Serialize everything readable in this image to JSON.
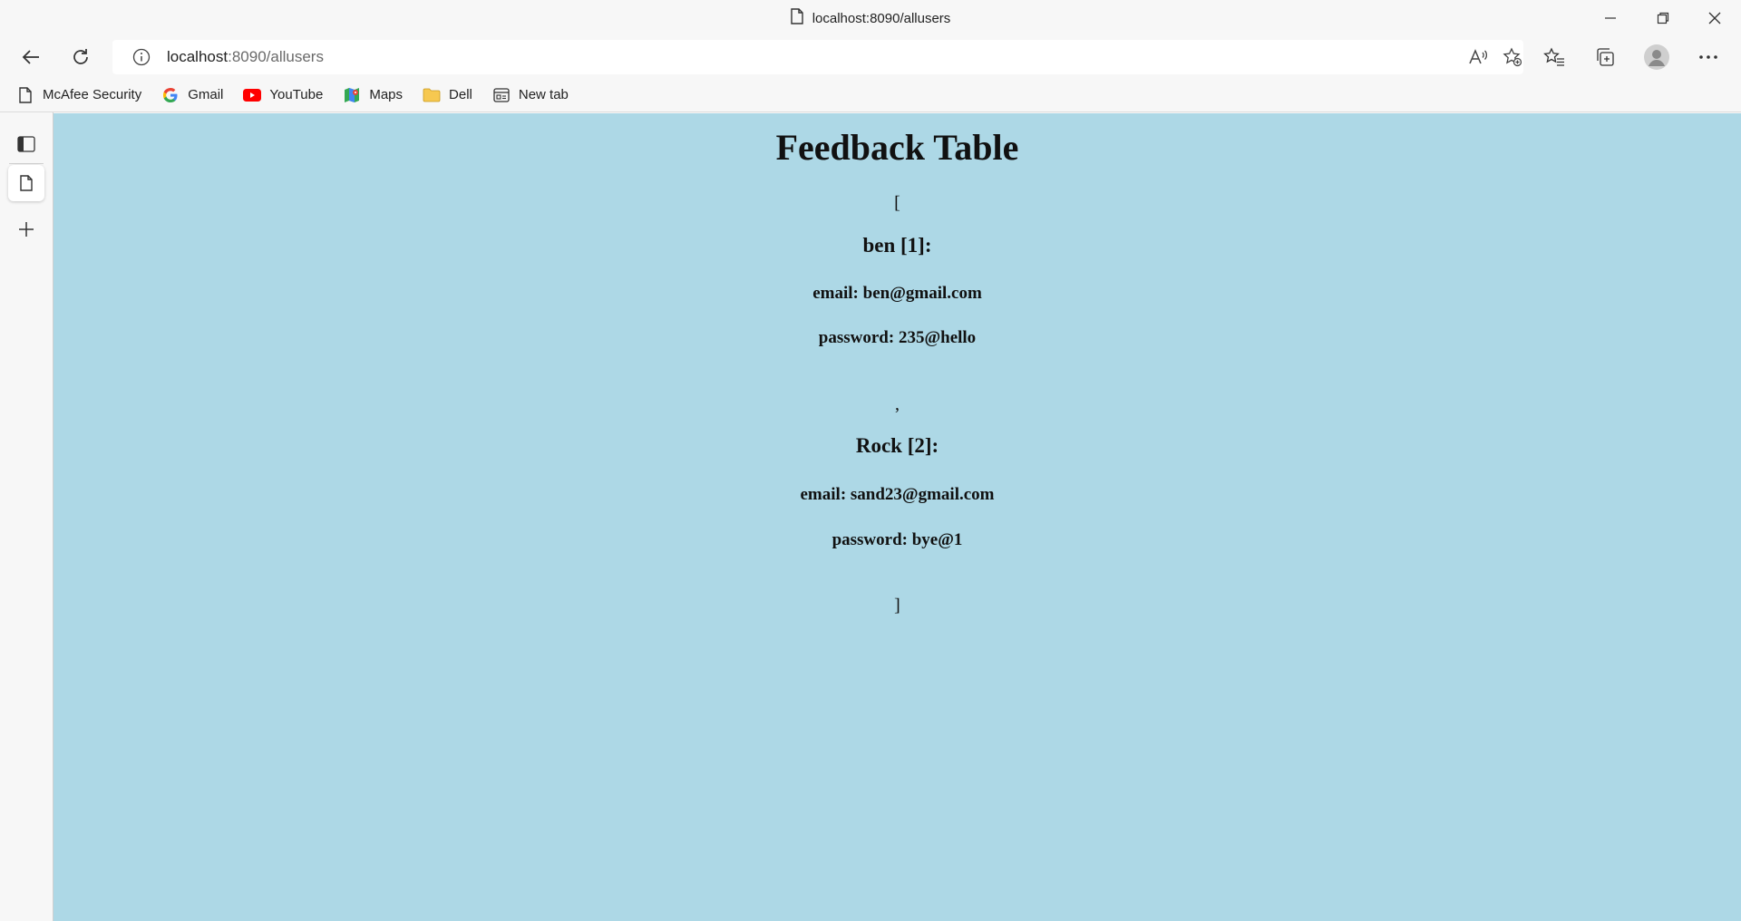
{
  "window": {
    "title": "localhost:8090/allusers"
  },
  "address": {
    "host": "localhost",
    "path": ":8090/allusers"
  },
  "favorites": [
    {
      "label": "McAfee Security",
      "icon": "page-icon"
    },
    {
      "label": "Gmail",
      "icon": "google-icon"
    },
    {
      "label": "YouTube",
      "icon": "youtube-icon"
    },
    {
      "label": "Maps",
      "icon": "maps-icon"
    },
    {
      "label": "Dell",
      "icon": "folder-icon"
    },
    {
      "label": "New tab",
      "icon": "newtab-icon"
    }
  ],
  "page": {
    "title": "Feedback Table",
    "open_bracket": "[",
    "separator": ",",
    "close_bracket": "]",
    "users": [
      {
        "heading": "ben [1]:",
        "email": "email: ben@gmail.com",
        "password": "password: 235@hello"
      },
      {
        "heading": "Rock [2]:",
        "email": "email: sand23@gmail.com",
        "password": "password: bye@1"
      }
    ]
  },
  "colors": {
    "page_background": "#add8e6",
    "chrome_background": "#f7f7f7"
  }
}
